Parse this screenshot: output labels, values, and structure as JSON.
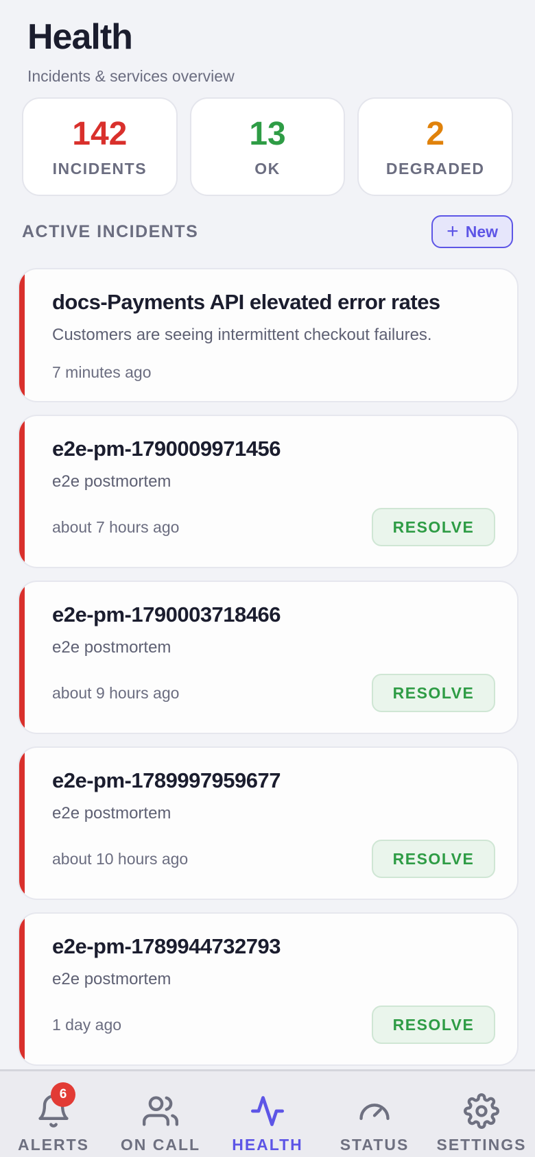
{
  "header": {
    "title": "Health",
    "subtitle": "Incidents & services overview"
  },
  "stats": [
    {
      "value": "142",
      "label": "INCIDENTS",
      "color": "#d9302c"
    },
    {
      "value": "13",
      "label": "OK",
      "color": "#2e9c45"
    },
    {
      "value": "2",
      "label": "DEGRADED",
      "color": "#e0820b"
    }
  ],
  "section": {
    "title": "ACTIVE INCIDENTS",
    "new_icon": "plus-icon",
    "new_label": "New"
  },
  "incidents": [
    {
      "title": "docs-Payments API elevated error rates",
      "description": "Customers are seeing intermittent checkout failures.",
      "time": "7 minutes ago",
      "action": ""
    },
    {
      "title": "e2e-pm-1790009971456",
      "description": "e2e postmortem",
      "time": "about 7 hours ago",
      "action": "RESOLVE"
    },
    {
      "title": "e2e-pm-1790003718466",
      "description": "e2e postmortem",
      "time": "about 9 hours ago",
      "action": "RESOLVE"
    },
    {
      "title": "e2e-pm-1789997959677",
      "description": "e2e postmortem",
      "time": "about 10 hours ago",
      "action": "RESOLVE"
    },
    {
      "title": "e2e-pm-1789944732793",
      "description": "e2e postmortem",
      "time": "1 day ago",
      "action": "RESOLVE"
    }
  ],
  "tabs": [
    {
      "label": "ALERTS",
      "icon": "bell-icon",
      "badge": "6",
      "active": false
    },
    {
      "label": "ON CALL",
      "icon": "users-icon",
      "badge": "",
      "active": false
    },
    {
      "label": "HEALTH",
      "icon": "activity-icon",
      "badge": "",
      "active": true
    },
    {
      "label": "STATUS",
      "icon": "gauge-icon",
      "badge": "",
      "active": false
    },
    {
      "label": "SETTINGS",
      "icon": "gear-icon",
      "badge": "",
      "active": false
    }
  ],
  "colors": {
    "accent": "#5d55e6",
    "incident_bar": "#d9302c",
    "resolve_text": "#2e9c45",
    "badge": "#e23b35"
  }
}
